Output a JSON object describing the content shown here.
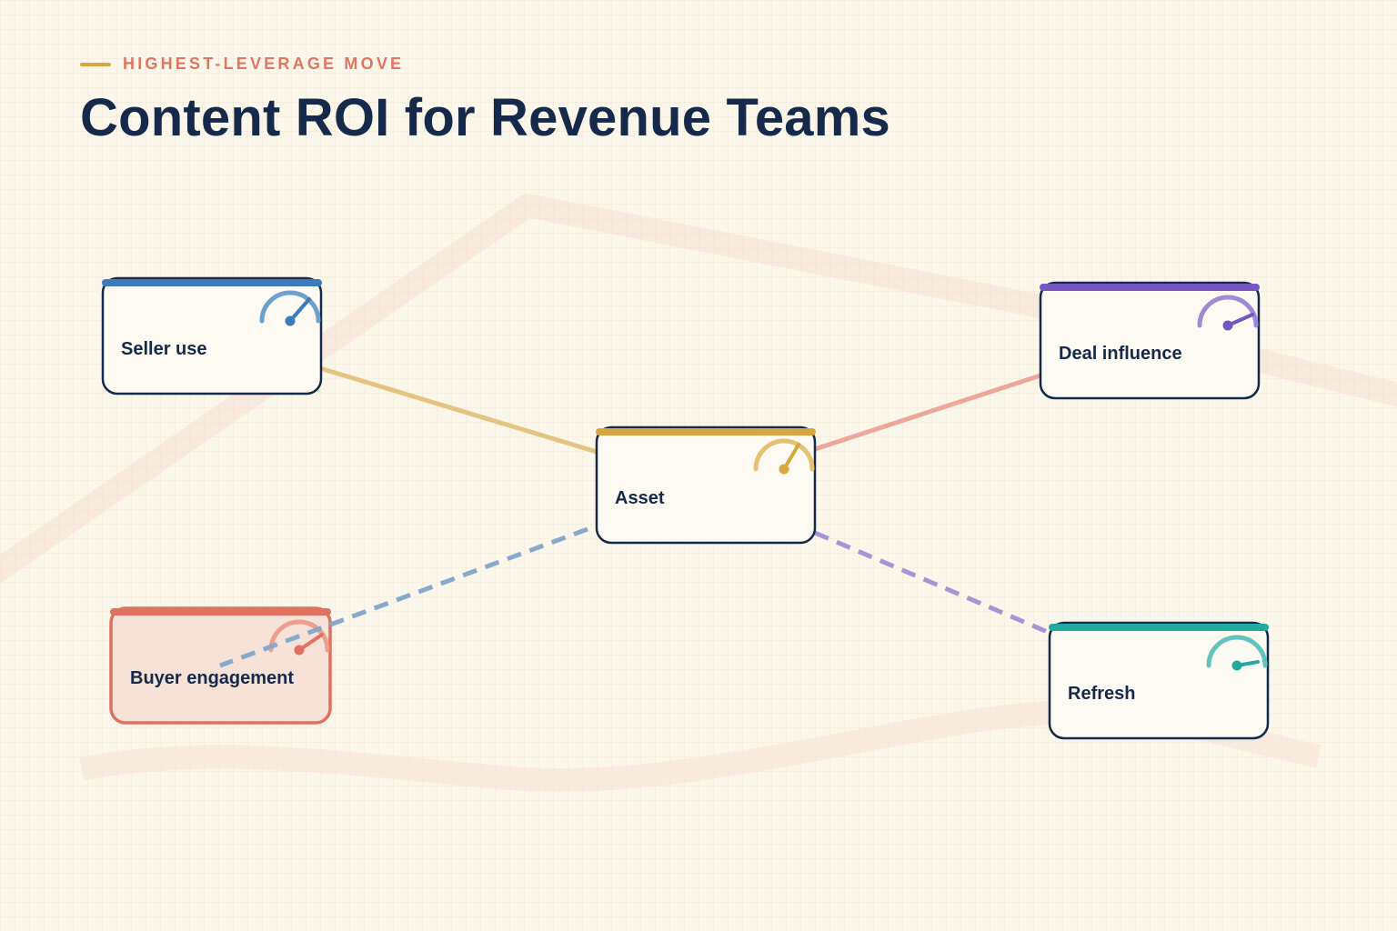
{
  "header": {
    "eyebrow": "HIGHEST-LEVERAGE MOVE",
    "title": "Content ROI for Revenue Teams"
  },
  "colors": {
    "navy": "#15294a",
    "eyebrow": "#df7662",
    "gold": "#d7a640",
    "blue": "#3b7bbd",
    "purple": "#7556c0",
    "coral": "#e07060",
    "teal": "#22aaa0"
  },
  "nodes": {
    "seller_use": {
      "label": "Seller use",
      "accent": "#3b7bbd",
      "gauge_icon": "gauge-icon"
    },
    "deal_influence": {
      "label": "Deal influence",
      "accent": "#7556c0",
      "gauge_icon": "gauge-icon"
    },
    "asset": {
      "label": "Asset",
      "accent": "#d7a640",
      "gauge_icon": "gauge-icon"
    },
    "buyer_engagement": {
      "label": "Buyer engagement",
      "accent": "#e07060",
      "gauge_icon": "gauge-icon",
      "highlighted": true
    },
    "refresh": {
      "label": "Refresh",
      "accent": "#22aaa0",
      "gauge_icon": "gauge-icon"
    }
  },
  "connections": [
    {
      "from": "seller_use",
      "to": "asset",
      "style": "solid",
      "color": "#e3c480"
    },
    {
      "from": "asset",
      "to": "deal_influence",
      "style": "solid",
      "color": "#eba79a"
    },
    {
      "from": "asset",
      "to": "buyer_engagement",
      "style": "dashed",
      "color": "#88a8cc"
    },
    {
      "from": "asset",
      "to": "refresh",
      "style": "dashed",
      "color": "#a595d4"
    }
  ]
}
